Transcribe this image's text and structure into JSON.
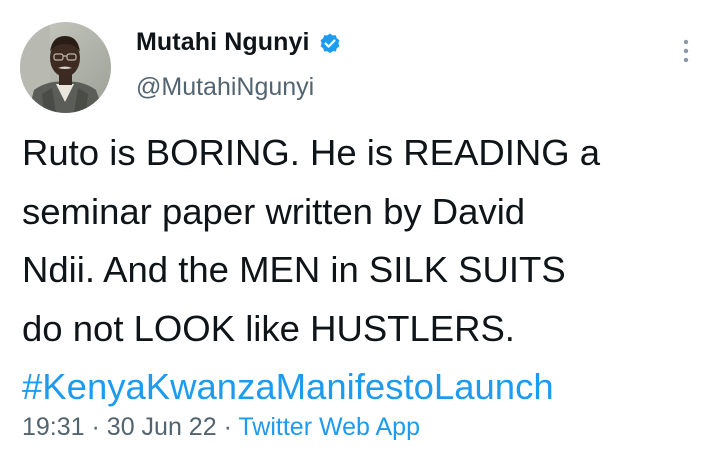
{
  "author": {
    "display_name": "Mutahi Ngunyi",
    "handle": "@MutahiNgunyi",
    "avatar_icon": "profile-photo",
    "verified_icon": "verified-badge-icon"
  },
  "tweet": {
    "lines": [
      "Ruto is BORING. He is READING a",
      "seminar paper written by David",
      "Ndii. And the MEN in SILK SUITS",
      "do not LOOK like HUSTLERS."
    ],
    "hashtag": "#KenyaKwanzaManifestoLaunch"
  },
  "meta": {
    "time": "19:31",
    "separator": "·",
    "date": "30 Jun 22",
    "source": "Twitter Web App"
  },
  "colors": {
    "link": "#1d9bf0",
    "text": "#0f1419",
    "muted": "#536471"
  },
  "more_icon": "more-options-icon"
}
